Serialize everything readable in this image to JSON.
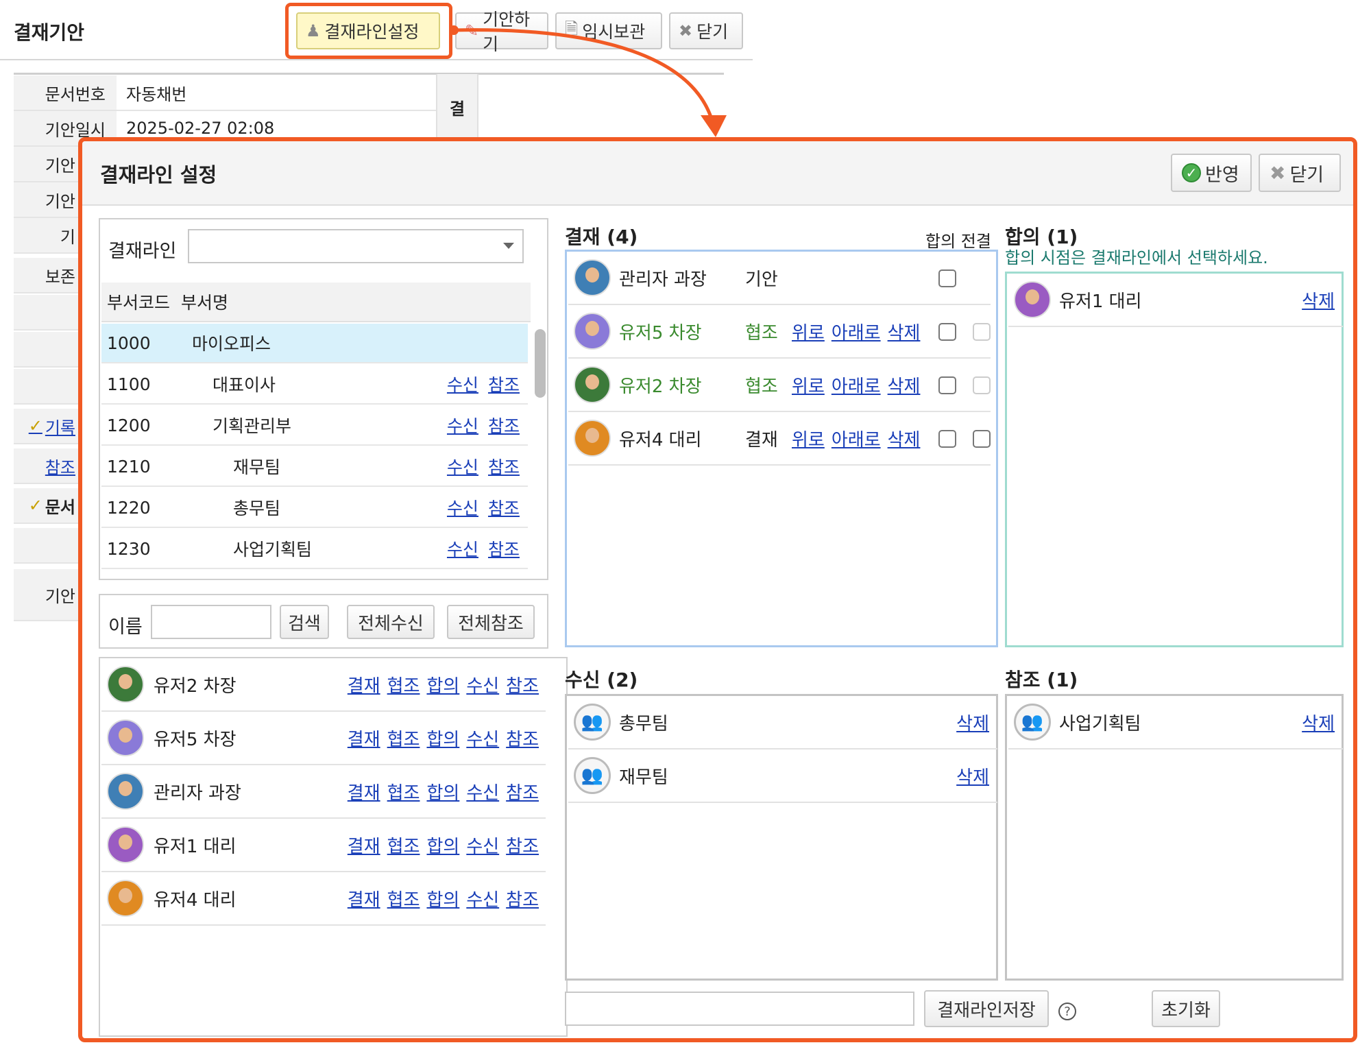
{
  "page": {
    "title": "결재기안",
    "toolbar": {
      "approval_line_setting": "결재라인설정",
      "draft": "기안하기",
      "temp_save": "임시보관",
      "close": "닫기"
    },
    "doc_fields": [
      {
        "label": "문서번호",
        "value": "자동채번"
      },
      {
        "label": "기안일시",
        "value": "2025-02-27 02:08"
      }
    ],
    "gyeol_label": "결",
    "side_labels": [
      "기안",
      "기안",
      "기안",
      "기",
      "보존",
      "",
      "",
      "",
      "기록",
      "참조",
      "문서",
      "",
      "기안"
    ]
  },
  "modal": {
    "title": "결재라인 설정",
    "apply_label": "반영",
    "close_label": "닫기",
    "line_select_label": "결재라인",
    "line_select_value": "",
    "dept_table": {
      "headers": [
        "부서코드",
        "부서명"
      ],
      "rows": [
        {
          "code": "1000",
          "name": "마이오피스",
          "receive": "",
          "ref": ""
        },
        {
          "code": "1100",
          "name": "대표이사",
          "receive": "수신",
          "ref": "참조"
        },
        {
          "code": "1200",
          "name": "기획관리부",
          "receive": "수신",
          "ref": "참조"
        },
        {
          "code": "1210",
          "name": "재무팀",
          "receive": "수신",
          "ref": "참조"
        },
        {
          "code": "1220",
          "name": "총무팀",
          "receive": "수신",
          "ref": "참조"
        },
        {
          "code": "1230",
          "name": "사업기획팀",
          "receive": "수신",
          "ref": "참조"
        }
      ]
    },
    "search": {
      "name_label": "이름",
      "name_value": "",
      "search_btn": "검색",
      "all_receive_btn": "전체수신",
      "all_ref_btn": "전체참조"
    },
    "users": [
      {
        "name": "유저2 차장"
      },
      {
        "name": "유저5 차장"
      },
      {
        "name": "관리자 과장"
      },
      {
        "name": "유저1 대리"
      },
      {
        "name": "유저4 대리"
      }
    ],
    "user_actions": [
      "결재",
      "협조",
      "합의",
      "수신",
      "참조"
    ],
    "approval": {
      "title": "결재 (4)",
      "prior_agree_label": "합의 전결",
      "rows": [
        {
          "name": "관리자 과장",
          "type": "기안",
          "up": "",
          "down": "",
          "del": ""
        },
        {
          "name": "유저5 차장",
          "type": "협조",
          "up": "위로",
          "down": "아래로",
          "del": "삭제"
        },
        {
          "name": "유저2 차장",
          "type": "협조",
          "up": "위로",
          "down": "아래로",
          "del": "삭제"
        },
        {
          "name": "유저4 대리",
          "type": "결재",
          "up": "위로",
          "down": "아래로",
          "del": "삭제"
        }
      ]
    },
    "agree": {
      "title": "합의 (1)",
      "note": "합의 시점은 결재라인에서 선택하세요.",
      "rows": [
        {
          "name": "유저1 대리",
          "del": "삭제"
        }
      ]
    },
    "receive": {
      "title": "수신 (2)",
      "rows": [
        {
          "name": "총무팀",
          "del": "삭제"
        },
        {
          "name": "재무팀",
          "del": "삭제"
        }
      ]
    },
    "reference": {
      "title": "참조 (1)",
      "rows": [
        {
          "name": "사업기획팀",
          "del": "삭제"
        }
      ]
    },
    "footer": {
      "line_name_value": "",
      "save_btn": "결재라인저장",
      "reset_btn": "초기화"
    }
  },
  "colors": {
    "highlight": "#f15a24",
    "approval_border": "#a9c9ef",
    "agree_border": "#9fdcd0",
    "link": "#1a3fb8",
    "green_text": "#3a8a2e"
  }
}
